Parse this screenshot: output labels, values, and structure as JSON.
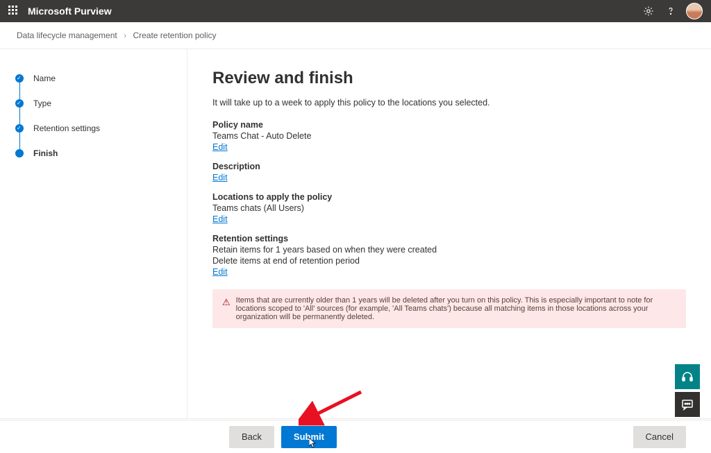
{
  "topbar": {
    "title": "Microsoft Purview"
  },
  "breadcrumb": {
    "part1": "Data lifecycle management",
    "part2": "Create retention policy"
  },
  "steps": [
    {
      "label": "Name",
      "done": true
    },
    {
      "label": "Type",
      "done": true
    },
    {
      "label": "Retention settings",
      "done": true
    },
    {
      "label": "Finish",
      "current": true
    }
  ],
  "main": {
    "heading": "Review and finish",
    "subtext": "It will take up to a week to apply this policy to the locations you selected.",
    "policy_name_label": "Policy name",
    "policy_name_value": "Teams Chat - Auto Delete",
    "description_label": "Description",
    "locations_label": "Locations to apply the policy",
    "locations_value": "Teams chats (All Users)",
    "retention_label": "Retention settings",
    "retention_value_1": "Retain items for 1 years based on when they were created",
    "retention_value_2": "Delete items at end of retention period",
    "edit_label": "Edit",
    "warning_text": "Items that are currently older than 1 years will be deleted after you turn on this policy. This is especially important to note for locations scoped to 'All' sources (for example, 'All Teams chats') because all matching items in those locations across your organization will be permanently deleted."
  },
  "footer": {
    "back": "Back",
    "submit": "Submit",
    "cancel": "Cancel"
  }
}
